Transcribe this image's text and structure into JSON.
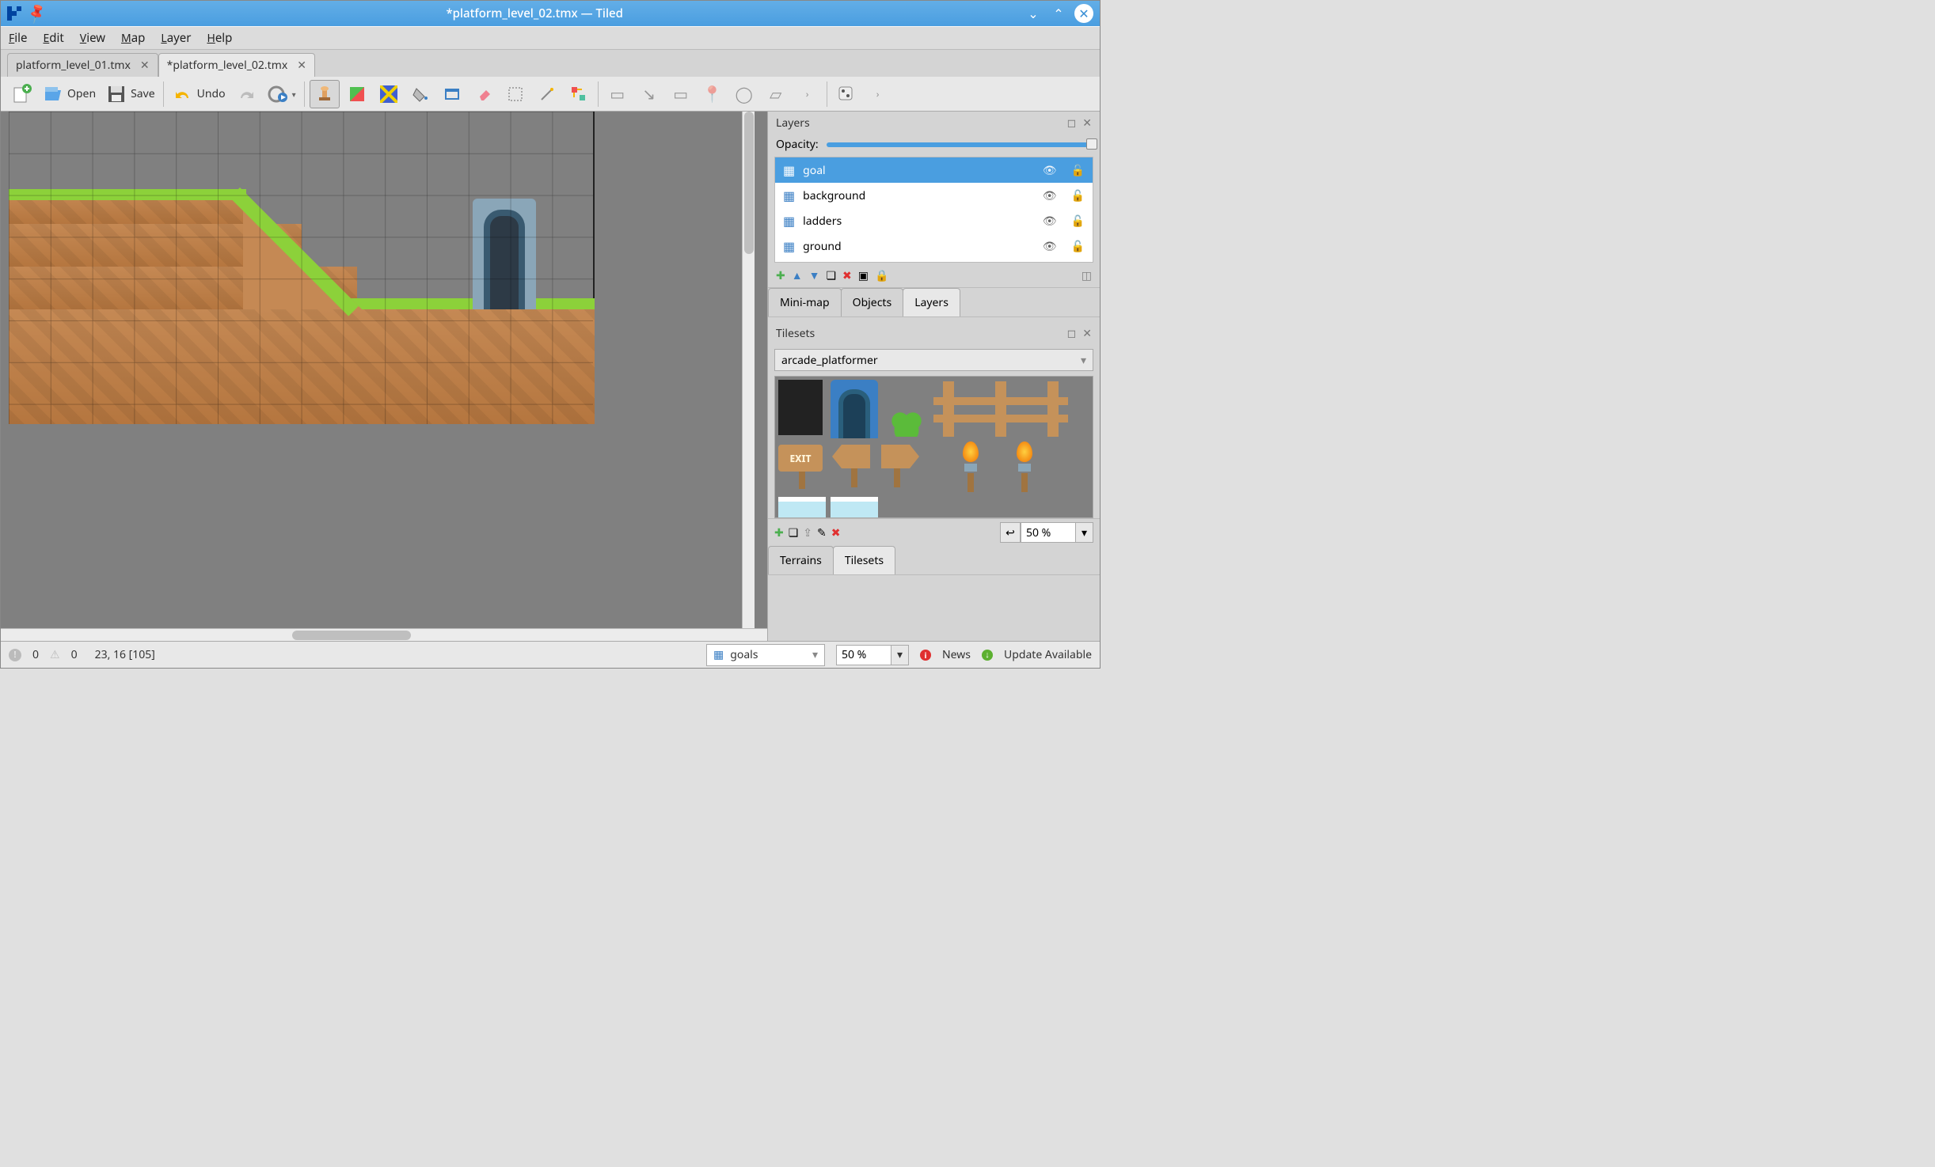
{
  "window": {
    "title": "*platform_level_02.tmx — Tiled"
  },
  "menus": [
    "File",
    "Edit",
    "View",
    "Map",
    "Layer",
    "Help"
  ],
  "doctabs": [
    {
      "label": "platform_level_01.tmx",
      "active": false
    },
    {
      "label": "*platform_level_02.tmx",
      "active": true
    }
  ],
  "toolbar": {
    "open": "Open",
    "save": "Save",
    "undo": "Undo"
  },
  "panels": {
    "layers": {
      "title": "Layers",
      "opacity_label": "Opacity:",
      "items": [
        {
          "name": "goal",
          "selected": true
        },
        {
          "name": "background",
          "selected": false
        },
        {
          "name": "ladders",
          "selected": false
        },
        {
          "name": "ground",
          "selected": false
        }
      ],
      "tabs": [
        "Mini-map",
        "Objects",
        "Layers"
      ],
      "active_tab": "Layers"
    },
    "tilesets": {
      "title": "Tilesets",
      "selected": "arcade_platformer",
      "zoom": "50 %",
      "tabs": [
        "Terrains",
        "Tilesets"
      ],
      "active_tab": "Tilesets"
    }
  },
  "status": {
    "errors": "0",
    "warnings": "0",
    "coord": "23, 16 [105]",
    "layer_sel": "goals",
    "zoom": "50 %",
    "news": "News",
    "update": "Update Available"
  }
}
